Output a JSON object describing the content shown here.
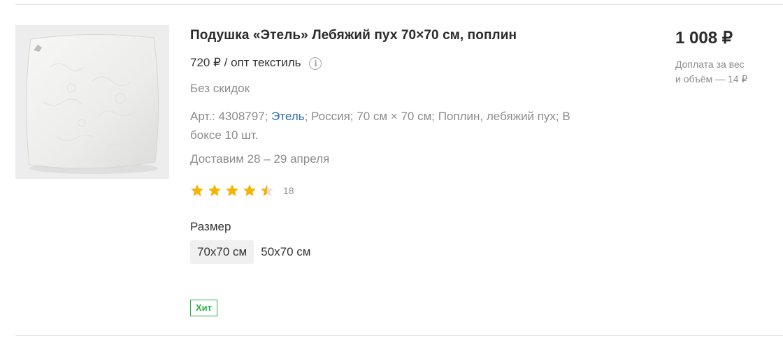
{
  "product": {
    "title": "Подушка «Этель» Лебяжий пух 70×70 см, поплин",
    "wholesale_price": "720 ₽ / опт текстиль",
    "discount_note": "Без скидок",
    "specs": {
      "article": "Арт.: 4308797; ",
      "brand_link": "Этель",
      "details": "; Россия; 70 см × 70 см; Поплин, лебяжий пух; В боксе 10 шт."
    },
    "delivery": "Доставим 28 – 29 апреля",
    "rating": {
      "value": 4.5,
      "max": 5,
      "review_count": "18"
    },
    "size": {
      "label": "Размер",
      "options": [
        "70x70 см",
        "50x70 см"
      ],
      "selected": "70x70 см"
    },
    "badge": "Хит",
    "price": "1 008 ₽",
    "surcharge_line1": "Доплата за вес",
    "surcharge_line2": "и объём — 14 ₽"
  },
  "icons": {
    "info": "info-icon",
    "star": "star-icon"
  },
  "colors": {
    "link": "#2f6fb8",
    "star": "#f5b400",
    "badge": "#2bb34a",
    "muted": "#8c8c8c"
  }
}
